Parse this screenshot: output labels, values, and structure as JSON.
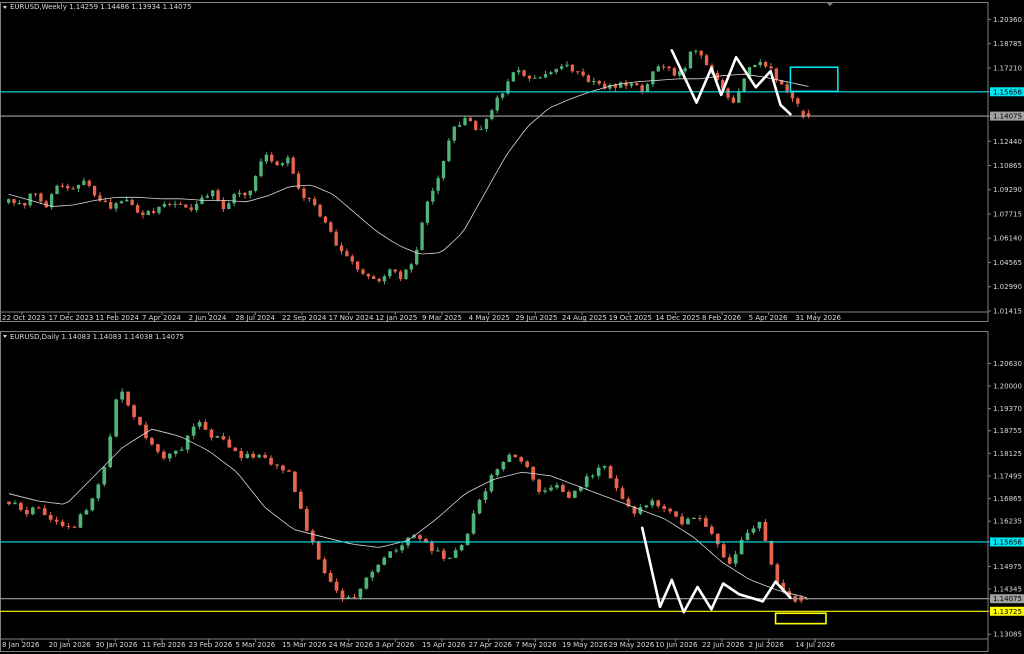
{
  "colors": {
    "background": "#000000",
    "axis": "#808080",
    "bull": "#4fb37a",
    "bear": "#e8654b",
    "ma": "#d9d9d9",
    "pattern": "#ffffff",
    "cyan": "#00e5f2",
    "yellow": "#ffff00",
    "grey_line": "#a0a0a0"
  },
  "chart_data": [
    {
      "type": "candlestick",
      "title": "EURUSD,Weekly  1.14259 1.14486 1.13934 1.14075",
      "ylim": [
        1.0141,
        1.2084
      ],
      "yticks": [
        "1.20360",
        "1.18785",
        "1.17210",
        "1.15656",
        "1.14075",
        "1.12440",
        "1.10865",
        "1.09290",
        "1.07715",
        "1.06140",
        "1.04565",
        "1.02990",
        "1.01415"
      ],
      "ytick_values": [
        1.2036,
        1.18785,
        1.1721,
        1.15656,
        1.14075,
        1.1244,
        1.10865,
        1.0929,
        1.07715,
        1.0614,
        1.04565,
        1.0299,
        1.01415
      ],
      "xticks": [
        "22 Oct 2023",
        "17 Dec 2023",
        "11 Feb 2024",
        "7 Apr 2024",
        "2 Jun 2024",
        "28 Jul 2024",
        "22 Sep 2024",
        "17 Nov 2024",
        "12 Jan 2025",
        "9 Mar 2025",
        "4 May 2025",
        "29 Jun 2025",
        "24 Aug 2025",
        "19 Oct 2025",
        "14 Dec 2025",
        "8 Feb 2026",
        "5 Apr 2026",
        "31 May 2026"
      ],
      "close_anchors": [
        1.085,
        1.082,
        1.092,
        1.083,
        1.096,
        1.093,
        1.098,
        1.087,
        1.081,
        1.088,
        1.079,
        1.077,
        1.083,
        1.086,
        1.08,
        1.084,
        1.093,
        1.08,
        1.092,
        1.09,
        1.115,
        1.11,
        1.112,
        1.09,
        1.086,
        1.07,
        1.055,
        1.045,
        1.038,
        1.032,
        1.04,
        1.035,
        1.05,
        1.085,
        1.106,
        1.132,
        1.14,
        1.13,
        1.145,
        1.158,
        1.172,
        1.165,
        1.168,
        1.17,
        1.173,
        1.168,
        1.163,
        1.158,
        1.162,
        1.16,
        1.158,
        1.172,
        1.17,
        1.168,
        1.186,
        1.172,
        1.162,
        1.15,
        1.168,
        1.178,
        1.17,
        1.16,
        1.15,
        1.141
      ],
      "ma_anchors": [
        1.09,
        1.086,
        1.082,
        1.083,
        1.086,
        1.088,
        1.088,
        1.087,
        1.087,
        1.086,
        1.086,
        1.085,
        1.089,
        1.095,
        1.096,
        1.09,
        1.078,
        1.066,
        1.057,
        1.051,
        1.052,
        1.065,
        1.09,
        1.115,
        1.134,
        1.146,
        1.152,
        1.157,
        1.161,
        1.163,
        1.164,
        1.165,
        1.165,
        1.167,
        1.168,
        1.166,
        1.163,
        1.16
      ],
      "pattern_points": [
        [
          0.68,
          1.1835
        ],
        [
          0.705,
          1.1495
        ],
        [
          0.72,
          1.172
        ],
        [
          0.73,
          1.1545
        ],
        [
          0.745,
          1.179
        ],
        [
          0.765,
          1.1595
        ],
        [
          0.78,
          1.17
        ],
        [
          0.79,
          1.148
        ],
        [
          0.8,
          1.142
        ]
      ],
      "hlines": [
        {
          "value": 1.15656,
          "label": "1.15656",
          "color": "#00e5f2"
        },
        {
          "value": 1.14075,
          "label": "1.14075",
          "color": "#a0a0a0"
        }
      ],
      "boxes": [
        {
          "x0": 0.8,
          "x1": 0.848,
          "y0": 1.1725,
          "y1": 1.1568,
          "color": "#00e5f2"
        }
      ],
      "last_candles": [
        [
          1.144,
          1.145,
          1.1393,
          1.14
        ],
        [
          1.1426,
          1.1449,
          1.1393,
          1.14075
        ]
      ]
    },
    {
      "type": "candlestick",
      "title": "EURUSD,Daily  1.14083 1.14083 1.14038 1.14075",
      "ylim": [
        1.1298,
        1.212
      ],
      "yticks": [
        "1.20630",
        "1.20000",
        "1.19370",
        "1.18755",
        "1.18125",
        "1.17495",
        "1.16865",
        "1.16235",
        "1.15656",
        "1.14975",
        "1.14345",
        "1.14075",
        "1.13725",
        "1.13085"
      ],
      "ytick_values": [
        1.2063,
        1.2,
        1.1937,
        1.18755,
        1.18125,
        1.17495,
        1.16865,
        1.16235,
        1.15656,
        1.14975,
        1.14345,
        1.14075,
        1.13725,
        1.13085
      ],
      "xticks": [
        "8 Jan 2026",
        "20 Jan 2026",
        "30 Jan 2026",
        "11 Feb 2026",
        "23 Feb 2026",
        "5 Mar 2026",
        "15 Mar 2026",
        "24 Mar 2026",
        "3 Apr 2026",
        "15 Apr 2026",
        "27 Apr 2026",
        "7 May 2026",
        "19 May 2026",
        "29 May 2026",
        "10 Jun 2026",
        "22 Jun 2026",
        "2 Jul 2026",
        "14 Jul 2026"
      ],
      "close_anchors": [
        1.168,
        1.165,
        1.166,
        1.162,
        1.16,
        1.166,
        1.175,
        1.2,
        1.192,
        1.184,
        1.18,
        1.182,
        1.19,
        1.186,
        1.184,
        1.18,
        1.181,
        1.178,
        1.175,
        1.16,
        1.15,
        1.142,
        1.14,
        1.148,
        1.152,
        1.156,
        1.158,
        1.155,
        1.151,
        1.156,
        1.168,
        1.176,
        1.181,
        1.178,
        1.17,
        1.172,
        1.169,
        1.175,
        1.178,
        1.17,
        1.165,
        1.168,
        1.166,
        1.162,
        1.164,
        1.158,
        1.15,
        1.158,
        1.162,
        1.145,
        1.14,
        1.141
      ],
      "ma_anchors": [
        1.17,
        1.168,
        1.167,
        1.175,
        1.183,
        1.188,
        1.186,
        1.182,
        1.176,
        1.166,
        1.16,
        1.158,
        1.156,
        1.155,
        1.157,
        1.163,
        1.17,
        1.174,
        1.176,
        1.175,
        1.172,
        1.169,
        1.166,
        1.163,
        1.158,
        1.151,
        1.146,
        1.143,
        1.141
      ],
      "pattern_points": [
        [
          0.65,
          1.1605
        ],
        [
          0.668,
          1.1385
        ],
        [
          0.68,
          1.146
        ],
        [
          0.692,
          1.137
        ],
        [
          0.706,
          1.144
        ],
        [
          0.72,
          1.1378
        ],
        [
          0.732,
          1.145
        ],
        [
          0.748,
          1.142
        ],
        [
          0.76,
          1.141
        ],
        [
          0.772,
          1.14
        ],
        [
          0.785,
          1.1455
        ],
        [
          0.8,
          1.141
        ]
      ],
      "hlines": [
        {
          "value": 1.15656,
          "label": "1.15656",
          "color": "#00e5f2"
        },
        {
          "value": 1.14075,
          "label": "1.14075",
          "color": "#a0a0a0"
        },
        {
          "value": 1.13725,
          "label": "1.13725",
          "color": "#ffff00"
        }
      ],
      "boxes": [
        {
          "x0": 0.785,
          "x1": 0.836,
          "y0": 1.1367,
          "y1": 1.1338,
          "color": "#ffff00"
        }
      ],
      "last_candles": [
        [
          1.1412,
          1.1418,
          1.1395,
          1.1402
        ],
        [
          1.14083,
          1.14083,
          1.14038,
          1.14075
        ]
      ]
    }
  ]
}
